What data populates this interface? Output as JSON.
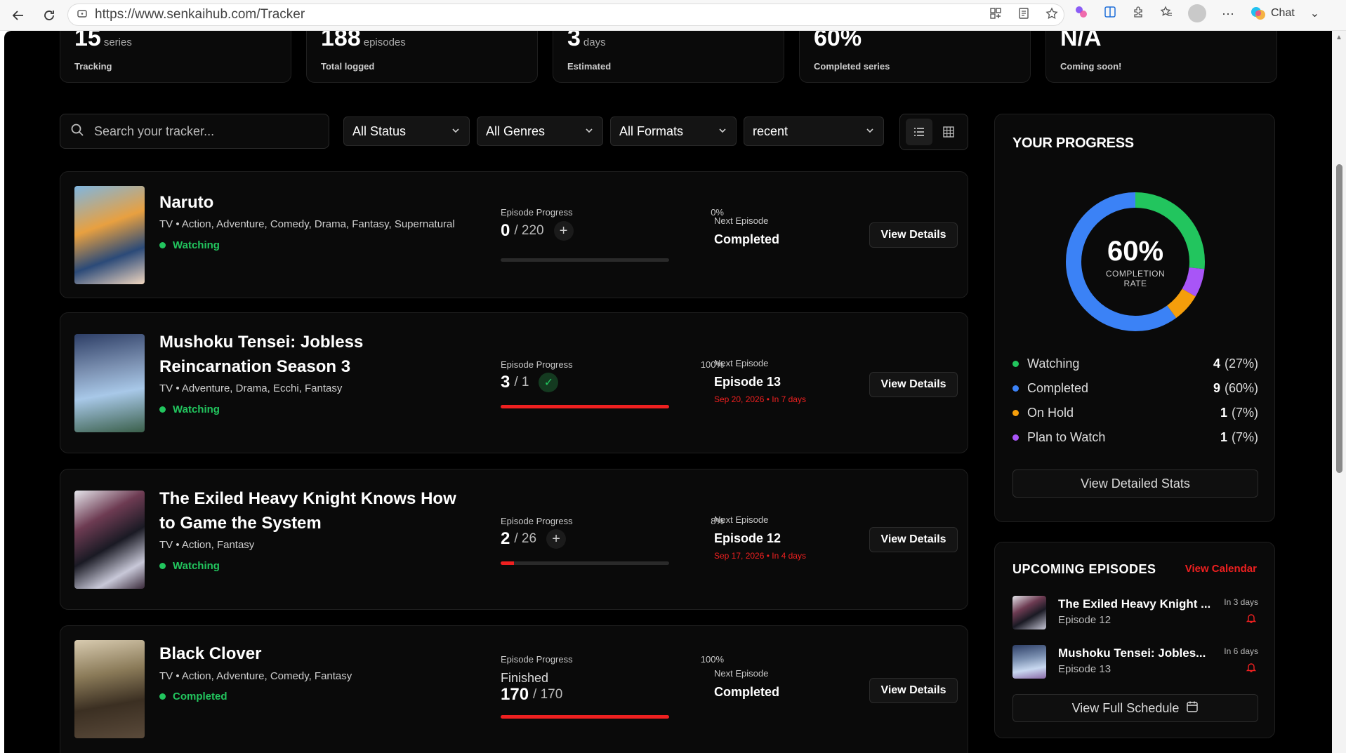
{
  "browser": {
    "url": "https://www.senkaihub.com/Tracker",
    "chat_label": "Chat"
  },
  "stats": [
    {
      "value": "15",
      "unit": "series",
      "label": "Tracking"
    },
    {
      "value": "188",
      "unit": "episodes",
      "label": "Total logged"
    },
    {
      "value": "3",
      "unit": "days",
      "label": "Estimated"
    },
    {
      "value": "60%",
      "unit": "",
      "label": "Completed series"
    },
    {
      "value": "N/A",
      "unit": "",
      "label": "Coming soon!"
    }
  ],
  "filters": {
    "search_placeholder": "Search your tracker...",
    "status": "All Status",
    "genres": "All Genres",
    "formats": "All Formats",
    "sort": "recent"
  },
  "anime": [
    {
      "title": "Naruto",
      "meta": "TV • Action, Adventure, Comedy, Drama, Fantasy, Supernatural",
      "status": "Watching",
      "progress_label": "Episode Progress",
      "progress_pct": "0%",
      "progress_fraction": 0,
      "watched": "0",
      "total": "/ 220",
      "next_label": "Next Episode",
      "next_episode": "Completed",
      "next_date": "",
      "button": "View Details"
    },
    {
      "title": "Mushoku Tensei: Jobless Reincarnation Season 3",
      "meta": "TV • Adventure, Drama, Ecchi, Fantasy",
      "status": "Watching",
      "progress_label": "Episode Progress",
      "progress_pct": "100%",
      "progress_fraction": 1,
      "watched": "3",
      "total": "/ 1",
      "next_label": "Next Episode",
      "next_episode": "Episode 13",
      "next_date": "Sep 20, 2026 • In 7 days",
      "button": "View Details"
    },
    {
      "title": "The Exiled Heavy Knight Knows How to Game the System",
      "meta": "TV • Action, Fantasy",
      "status": "Watching",
      "progress_label": "Episode Progress",
      "progress_pct": "8%",
      "progress_fraction": 0.08,
      "watched": "2",
      "total": "/ 26",
      "next_label": "Next Episode",
      "next_episode": "Episode 12",
      "next_date": "Sep 17, 2026 • In 4 days",
      "button": "View Details"
    },
    {
      "title": "Black Clover",
      "meta": "TV • Action, Adventure, Comedy, Fantasy",
      "status": "Completed",
      "progress_label": "Episode Progress",
      "progress_pct": "100%",
      "progress_fraction": 1,
      "finished_label": "Finished",
      "watched": "170",
      "total": "/ 170",
      "next_label": "Next Episode",
      "next_episode": "Completed",
      "next_date": "",
      "button": "View Details"
    }
  ],
  "progress_panel": {
    "title": "YOUR PROGRESS",
    "center_value": "60%",
    "center_label_1": "COMPLETION",
    "center_label_2": "RATE",
    "legend": [
      {
        "label": "Watching",
        "count": "4",
        "pct": "(27%)",
        "color": "#22c55e"
      },
      {
        "label": "Completed",
        "count": "9",
        "pct": "(60%)",
        "color": "#3b82f6"
      },
      {
        "label": "On Hold",
        "count": "1",
        "pct": "(7%)",
        "color": "#f59e0b"
      },
      {
        "label": "Plan to Watch",
        "count": "1",
        "pct": "(7%)",
        "color": "#a855f7"
      }
    ],
    "button": "View Detailed Stats"
  },
  "upcoming": {
    "title": "UPCOMING EPISODES",
    "calendar_link": "View Calendar",
    "items": [
      {
        "title": "The Exiled Heavy Knight ...",
        "episode": "Episode 12",
        "when": "In 3 days"
      },
      {
        "title": "Mushoku Tensei: Jobles...",
        "episode": "Episode 13",
        "when": "In 6 days"
      }
    ],
    "button": "View Full Schedule"
  },
  "colors": {
    "accent": "#ef2020",
    "watching": "#22c55e",
    "completed": "#3b82f6",
    "on_hold": "#f59e0b",
    "plan": "#a855f7"
  }
}
